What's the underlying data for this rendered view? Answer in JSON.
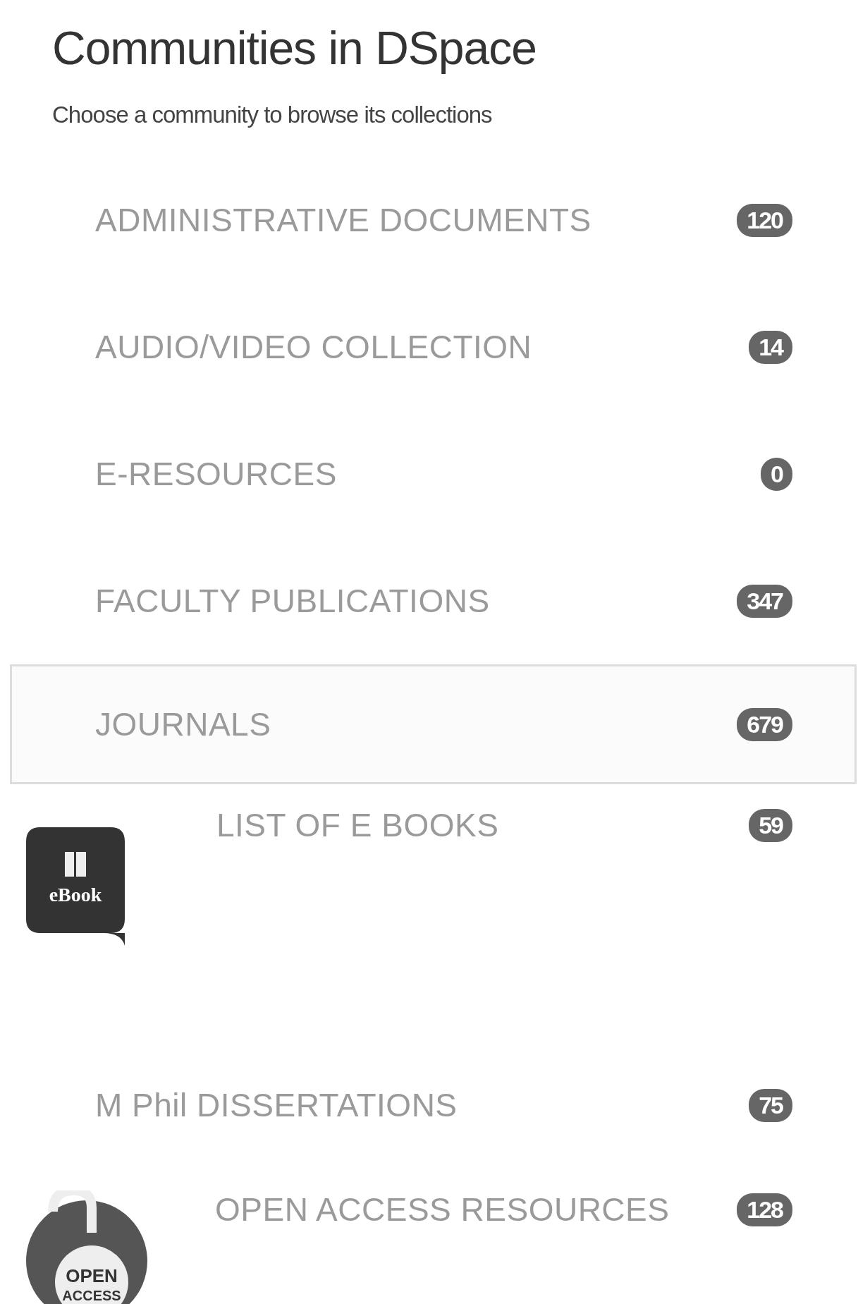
{
  "title": "Communities in DSpace",
  "subtitle": "Choose a community to browse its collections",
  "communities": [
    {
      "name": "ADMINISTRATIVE DOCUMENTS",
      "count": "120",
      "selected": false
    },
    {
      "name": "AUDIO/VIDEO COLLECTION",
      "count": "14",
      "selected": false
    },
    {
      "name": "E-RESOURCES",
      "count": "0",
      "selected": false
    },
    {
      "name": "FACULTY PUBLICATIONS",
      "count": "347",
      "selected": false
    },
    {
      "name": "JOURNALS",
      "count": "679",
      "selected": true
    },
    {
      "name": "LIST OF E BOOKS",
      "count": "59",
      "selected": false,
      "logo": {
        "kind": "ebook",
        "text": "eBook"
      }
    },
    {
      "name": "M Phil DISSERTATIONS",
      "count": "75",
      "selected": false
    },
    {
      "name": "OPEN ACCESS RESOURCES",
      "count": "128",
      "selected": false,
      "logo": {
        "kind": "open-access",
        "text": "OPEN ACCESS"
      }
    }
  ]
}
